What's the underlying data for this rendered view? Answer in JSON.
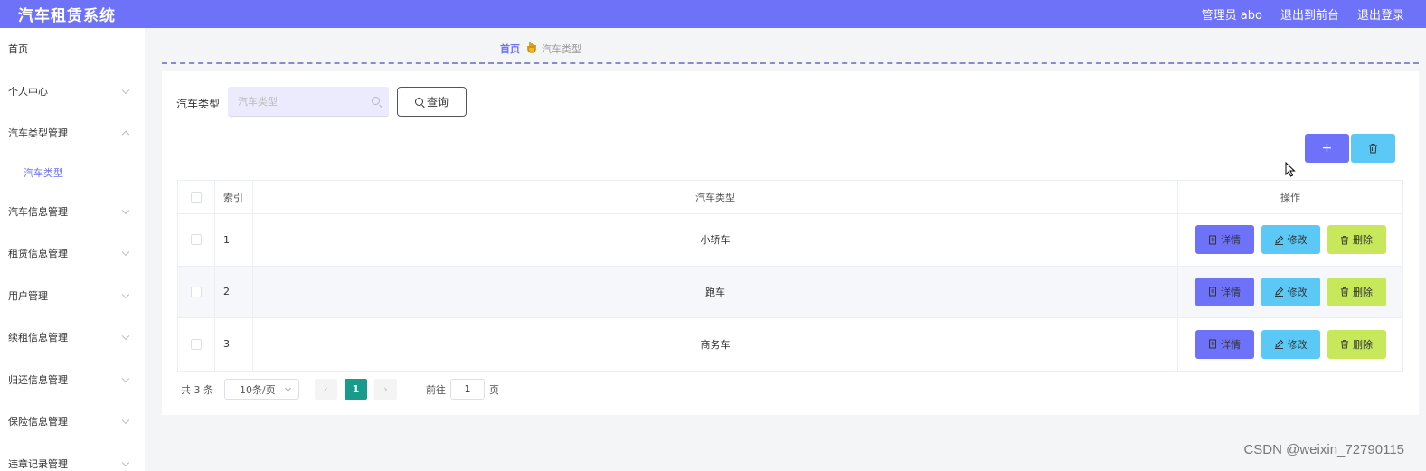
{
  "header": {
    "title": "汽车租赁系统",
    "admin_label": "管理员 abo",
    "to_front_label": "退出到前台",
    "logout_label": "退出登录",
    "accent_color": "#6e72f8"
  },
  "sidebar": {
    "items": [
      {
        "label": "首页",
        "chevron": "none"
      },
      {
        "label": "个人中心",
        "chevron": "down"
      },
      {
        "label": "汽车类型管理",
        "chevron": "up",
        "children": [
          {
            "label": "汽车类型",
            "active": true
          }
        ]
      },
      {
        "label": "汽车信息管理",
        "chevron": "down"
      },
      {
        "label": "租赁信息管理",
        "chevron": "down"
      },
      {
        "label": "用户管理",
        "chevron": "down"
      },
      {
        "label": "续租信息管理",
        "chevron": "down"
      },
      {
        "label": "归还信息管理",
        "chevron": "down"
      },
      {
        "label": "保险信息管理",
        "chevron": "down"
      },
      {
        "label": "违章记录管理",
        "chevron": "down"
      }
    ]
  },
  "breadcrumb": {
    "home": "首页",
    "current": "汽车类型",
    "separator_icon": "hand-icon"
  },
  "search": {
    "label": "汽车类型",
    "placeholder": "汽车类型",
    "button_label": "查询"
  },
  "toolbar": {
    "add_label": "+",
    "add_color": "#6e72f8",
    "delete_color": "#5bc8f6"
  },
  "table": {
    "columns": [
      "索引",
      "汽车类型",
      "操作"
    ],
    "rows": [
      {
        "index": "1",
        "type": "小轿车"
      },
      {
        "index": "2",
        "type": "跑车"
      },
      {
        "index": "3",
        "type": "商务车"
      }
    ],
    "ops": {
      "detail": "详情",
      "edit": "修改",
      "delete": "删除"
    },
    "op_colors": {
      "detail": "#6e72f8",
      "edit": "#5bc8f6",
      "delete": "#c6e85a"
    }
  },
  "pagination": {
    "total": "共 3 条",
    "page_size": "10条/页",
    "current_page": "1",
    "goto_prefix": "前往",
    "goto_value": "1",
    "goto_suffix": "页",
    "active_color": "#1a9a8a"
  },
  "watermark": "CSDN @weixin_72790115"
}
